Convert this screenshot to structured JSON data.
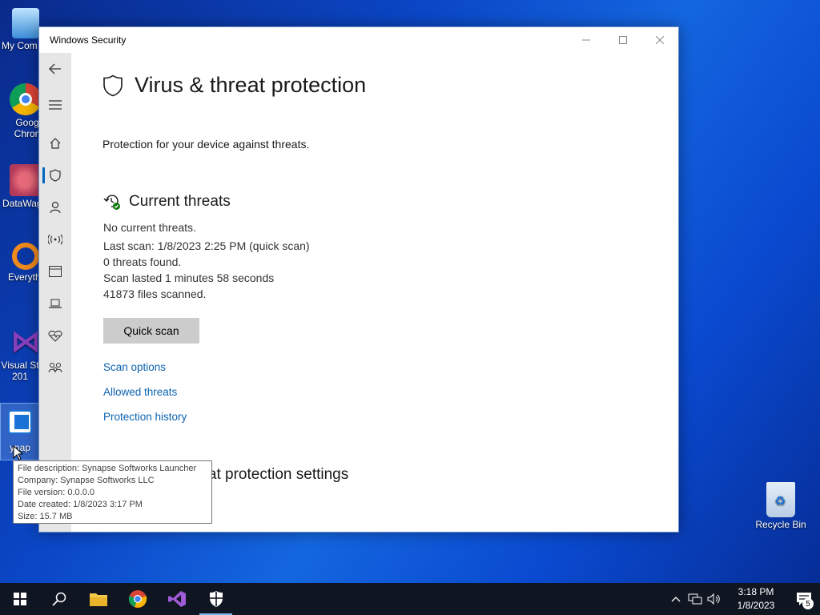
{
  "desktop": {
    "icons": [
      {
        "label": "My Com"
      },
      {
        "label": "Goog Chron"
      },
      {
        "label": "DataWag"
      },
      {
        "label": "Everyth"
      },
      {
        "label": "Visual St 201"
      },
      {
        "label": "ynap"
      },
      {
        "label": "Recycle Bin"
      }
    ]
  },
  "window": {
    "title": "Windows Security",
    "page_title": "Virus & threat protection",
    "subtitle": "Protection for your device against threats.",
    "current_threats": {
      "heading": "Current threats",
      "lines": [
        "No current threats.",
        "Last scan: 1/8/2023 2:25 PM (quick scan)",
        "0 threats found.",
        "Scan lasted 1 minutes 58 seconds",
        "41873 files scanned."
      ],
      "quick_scan_label": "Quick scan",
      "links": [
        "Scan options",
        "Allowed threats",
        "Protection history"
      ]
    },
    "settings_heading": "Virus & threat protection settings"
  },
  "tooltip": {
    "lines": [
      "File description: Synapse Softworks Launcher",
      "Company: Synapse Softworks LLC",
      "File version: 0.0.0.0",
      "Date created: 1/8/2023 3:17 PM",
      "Size: 15.7 MB"
    ]
  },
  "taskbar": {
    "time": "3:18 PM",
    "date": "1/8/2023",
    "notification_count": "5"
  },
  "colors": {
    "accent": "#0067c0",
    "link": "#0b63b0",
    "taskbar": "#101522"
  }
}
